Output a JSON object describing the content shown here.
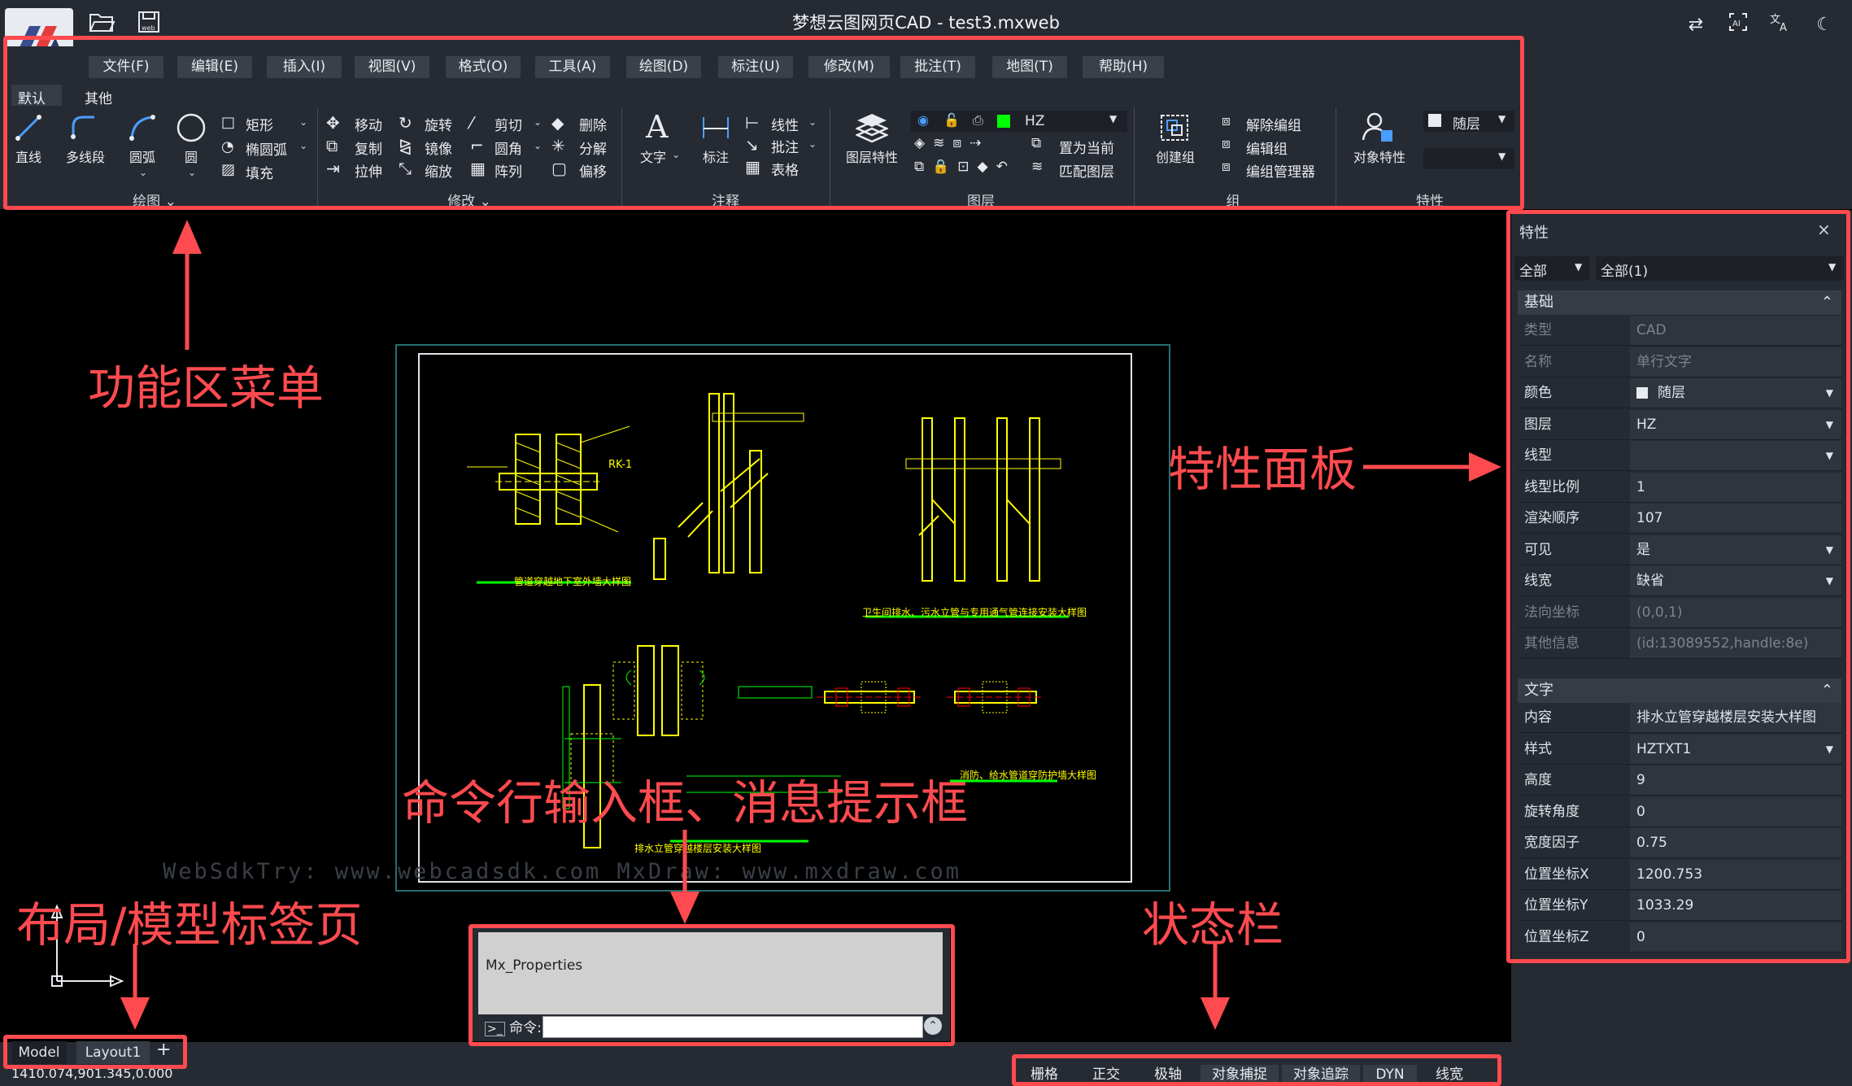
{
  "window": {
    "title": "梦想云图网页CAD - test3.mxweb"
  },
  "titlebar_icons": [
    "folder-open-icon",
    "save-web-icon",
    "swap-icon",
    "ai-icon",
    "translate-icon",
    "moon-icon"
  ],
  "menu": {
    "items": [
      "文件(F)",
      "编辑(E)",
      "插入(I)",
      "视图(V)",
      "格式(O)",
      "工具(A)",
      "绘图(D)",
      "标注(U)",
      "修改(M)",
      "批注(T)",
      "地图(T)",
      "帮助(H)"
    ]
  },
  "ribbon": {
    "tabs": [
      "默认",
      "其他"
    ],
    "groups": {
      "draw": {
        "name": "绘图",
        "big": [
          "直线",
          "多线段",
          "圆弧",
          "圆"
        ],
        "small": [
          "矩形",
          "椭圆弧",
          "填充"
        ]
      },
      "modify": {
        "name": "修改",
        "col1": [
          "移动",
          "复制",
          "拉伸"
        ],
        "col2": [
          "旋转",
          "镜像",
          "缩放"
        ],
        "col3": [
          "剪切",
          "圆角",
          "阵列"
        ],
        "col4": [
          "删除",
          "分解",
          "偏移"
        ]
      },
      "annotate": {
        "name": "注释",
        "big": [
          "文字",
          "标注"
        ],
        "small": [
          "线性",
          "批注",
          "表格"
        ]
      },
      "layers": {
        "name": "图层",
        "big": "图层特性",
        "layer_value": "HZ",
        "small": [
          "置为当前",
          "匹配图层"
        ]
      },
      "group": {
        "name": "组",
        "big": "创建组",
        "small": [
          "解除编组",
          "编辑组",
          "编组管理器"
        ]
      },
      "properties": {
        "name": "特性",
        "big": "对象特性",
        "color_value": "随层"
      }
    }
  },
  "annotations": {
    "ribbon": "功能区菜单",
    "properties": "特性面板",
    "command": "命令行输入框、消息提示框",
    "layout": "布局/模型标签页",
    "status": "状态栏"
  },
  "watermark": "WebSdkTry: www.webcadsdk.com MxDraw: www.mxdraw.com",
  "drawing_labels": {
    "t1": "管道穿越地下室外墙大样图",
    "t2": "卫生间排水、污水立管与专用通气管连接安装大样图",
    "t3": "排水立管穿越楼层安装大样图",
    "t4": "消防、给水管道穿防护墙大样图",
    "note_rk": "RK-1"
  },
  "properties_panel": {
    "title": "特性",
    "close": "×",
    "filter1": "全部",
    "filter2": "全部(1)",
    "section_basic": "基础",
    "basic": [
      {
        "label": "类型",
        "value": "CAD",
        "disabled": true
      },
      {
        "label": "名称",
        "value": "单行文字",
        "disabled": true
      },
      {
        "label": "颜色",
        "value": "随层",
        "dropdown": true
      },
      {
        "label": "图层",
        "value": "HZ",
        "dropdown": true
      },
      {
        "label": "线型",
        "value": "",
        "dropdown": true
      },
      {
        "label": "线型比例",
        "value": "1"
      },
      {
        "label": "渲染顺序",
        "value": "107"
      },
      {
        "label": "可见",
        "value": "是",
        "dropdown": true
      },
      {
        "label": "线宽",
        "value": "缺省",
        "dropdown": true
      },
      {
        "label": "法向坐标",
        "value": "(0,0,1)",
        "disabled": true
      },
      {
        "label": "其他信息",
        "value": "(id:13089552,handle:8e)",
        "disabled": true
      }
    ],
    "section_text": "文字",
    "text": [
      {
        "label": "内容",
        "value": "排水立管穿越楼层安装大样图"
      },
      {
        "label": "样式",
        "value": "HZTXT1",
        "dropdown": true
      },
      {
        "label": "高度",
        "value": "9"
      },
      {
        "label": "旋转角度",
        "value": "0"
      },
      {
        "label": "宽度因子",
        "value": "0.75"
      },
      {
        "label": "位置坐标X",
        "value": "1200.753"
      },
      {
        "label": "位置坐标Y",
        "value": "1033.29"
      },
      {
        "label": "位置坐标Z",
        "value": "0"
      }
    ]
  },
  "command": {
    "message": "Mx_Properties",
    "prompt": "命令:",
    "input_value": ""
  },
  "layout_tabs": [
    "Model",
    "Layout1"
  ],
  "add_tab": "+",
  "coordinates": "1410.074,901.345,0.000",
  "status_bar": [
    "栅格",
    "正交",
    "极轴",
    "对象捕捉",
    "对象追踪",
    "DYN",
    "线宽"
  ],
  "status_active": [
    false,
    false,
    false,
    true,
    true,
    true,
    false
  ],
  "colors": {
    "accent_red": "#ff4b4f",
    "cad_yellow": "#ffff00",
    "cad_green": "#00ff00",
    "cad_red": "#ff0000",
    "panel_bg": "#262b33"
  }
}
